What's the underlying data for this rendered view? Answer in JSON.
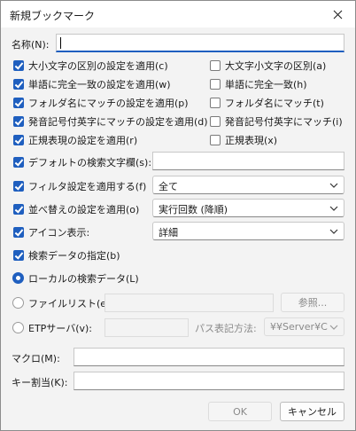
{
  "window": {
    "title": "新規ブックマーク"
  },
  "name_field": {
    "label": "名称(N):",
    "value": ""
  },
  "options_left": [
    {
      "label": "大小文字の区別の設定を適用(c)",
      "checked": true
    },
    {
      "label": "単語に完全一致の設定を適用(w)",
      "checked": true
    },
    {
      "label": "フォルダ名にマッチの設定を適用(p)",
      "checked": true
    },
    {
      "label": "発音記号付英字にマッチの設定を適用(d)",
      "checked": true
    },
    {
      "label": "正規表現の設定を適用(r)",
      "checked": true
    }
  ],
  "options_right": [
    {
      "label": "大文字小文字の区別(a)",
      "checked": false
    },
    {
      "label": "単語に完全一致(h)",
      "checked": false
    },
    {
      "label": "フォルダ名にマッチ(t)",
      "checked": false
    },
    {
      "label": "発音記号付英字にマッチ(i)",
      "checked": false
    },
    {
      "label": "正規表現(x)",
      "checked": false
    }
  ],
  "default_search": {
    "label": "デフォルトの検索文字欄(s):",
    "checked": true,
    "value": ""
  },
  "filter": {
    "label": "フィルタ設定を適用する(f)",
    "checked": true,
    "selected": "全て"
  },
  "sort": {
    "label": "並べ替えの設定を適用(o)",
    "checked": true,
    "selected": "実行回数 (降順)"
  },
  "icon_display": {
    "label": "アイコン表示:",
    "checked": true,
    "selected": "詳細"
  },
  "search_data": {
    "label": "検索データの指定(b)",
    "checked": true
  },
  "local_data": {
    "label": "ローカルの検索データ(L)",
    "selected": true
  },
  "file_list": {
    "label": "ファイルリスト(e):",
    "selected": false,
    "browse_label": "参照..."
  },
  "etp_server": {
    "label": "ETPサーバ(v):",
    "selected": false,
    "path_label": "パス表記方法:",
    "path_value": "¥¥Server¥C"
  },
  "macro": {
    "label": "マクロ(M):",
    "value": ""
  },
  "hotkey": {
    "label": "キー割当(K):",
    "value": ""
  },
  "buttons": {
    "ok": "OK",
    "cancel": "キャンセル"
  }
}
